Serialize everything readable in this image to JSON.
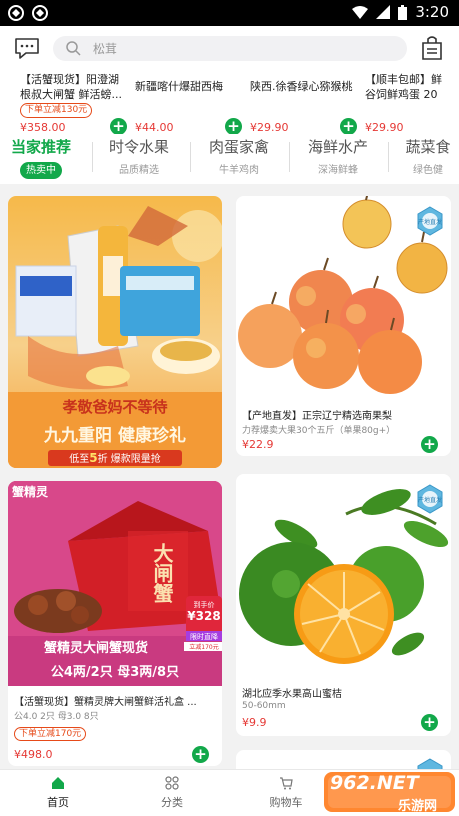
{
  "status_bar": {
    "time": "3:20"
  },
  "header": {
    "search_placeholder": "松茸"
  },
  "strip": [
    {
      "line1": "【活蟹现货】阳澄湖",
      "line2": "根叔大闸蟹 鲜活螃...",
      "badge": "下单立减130元",
      "price": "¥358.00"
    },
    {
      "line1": "",
      "line2": "新疆喀什爆甜西梅",
      "badge": "",
      "price": "¥44.00"
    },
    {
      "line1": "",
      "line2": "陕西.徐香绿心猕猴桃",
      "badge": "",
      "price": "¥29.90"
    },
    {
      "line1": "【顺丰包邮】鲜",
      "line2": "谷饲鲜鸡蛋 20",
      "badge": "",
      "price": "¥29.90"
    }
  ],
  "tabs": [
    {
      "title": "当家推荐",
      "sub": "热卖中",
      "active": true
    },
    {
      "title": "时令水果",
      "sub": "品质精选",
      "active": false
    },
    {
      "title": "肉蛋家禽",
      "sub": "牛羊鸡肉",
      "active": false
    },
    {
      "title": "海鲜水产",
      "sub": "深海鲜蜂",
      "active": false
    },
    {
      "title": "蔬菜食",
      "sub": "绿色健",
      "active": false
    }
  ],
  "banner": {
    "line1": "孝敬爸妈不等待",
    "line2": "九九重阳 健康珍礼",
    "ribbon_pre": "低至",
    "ribbon_num": "5",
    "ribbon_post": "折  爆款限量抢"
  },
  "products": [
    {
      "name": "【产地直发】正宗辽宁精选南果梨",
      "desc": "力荐爆卖大果30个五斤（单果80g+）",
      "badge": "",
      "price": "¥22.9",
      "origin_label": "产地直发"
    },
    {
      "name": "【活蟹现货】蟹精灵牌大闸蟹鲜活礼盒 ...",
      "desc": "公4.0 2只  母3.0 8只",
      "badge": "下单立减170元",
      "price": "¥498.0",
      "promo": {
        "brand": "蟹精灵",
        "slogan": "蟹精灵大闸蟹现货",
        "spec": "公4两/2只 母3两/8只",
        "box_text": "大闸蟹",
        "tag_top": "到手价",
        "tag_price": "¥328",
        "tag_strip": "限时直降",
        "tag_bottom": "立减170元"
      }
    },
    {
      "name": "湖北应季水果高山蜜桔",
      "desc": "50-60mm",
      "badge": "",
      "price": "¥9.9",
      "origin_label": "产地直发"
    }
  ],
  "nav": [
    {
      "label": "首页",
      "icon": "home-icon",
      "active": true
    },
    {
      "label": "分类",
      "icon": "category-icon",
      "active": false
    },
    {
      "label": "购物车",
      "icon": "cart-icon",
      "active": false
    }
  ],
  "watermark": {
    "brand": "962.NET",
    "sub": "乐游网"
  },
  "colors": {
    "accent": "#12a84a",
    "price": "#e53935",
    "badge": "#e64a19"
  }
}
